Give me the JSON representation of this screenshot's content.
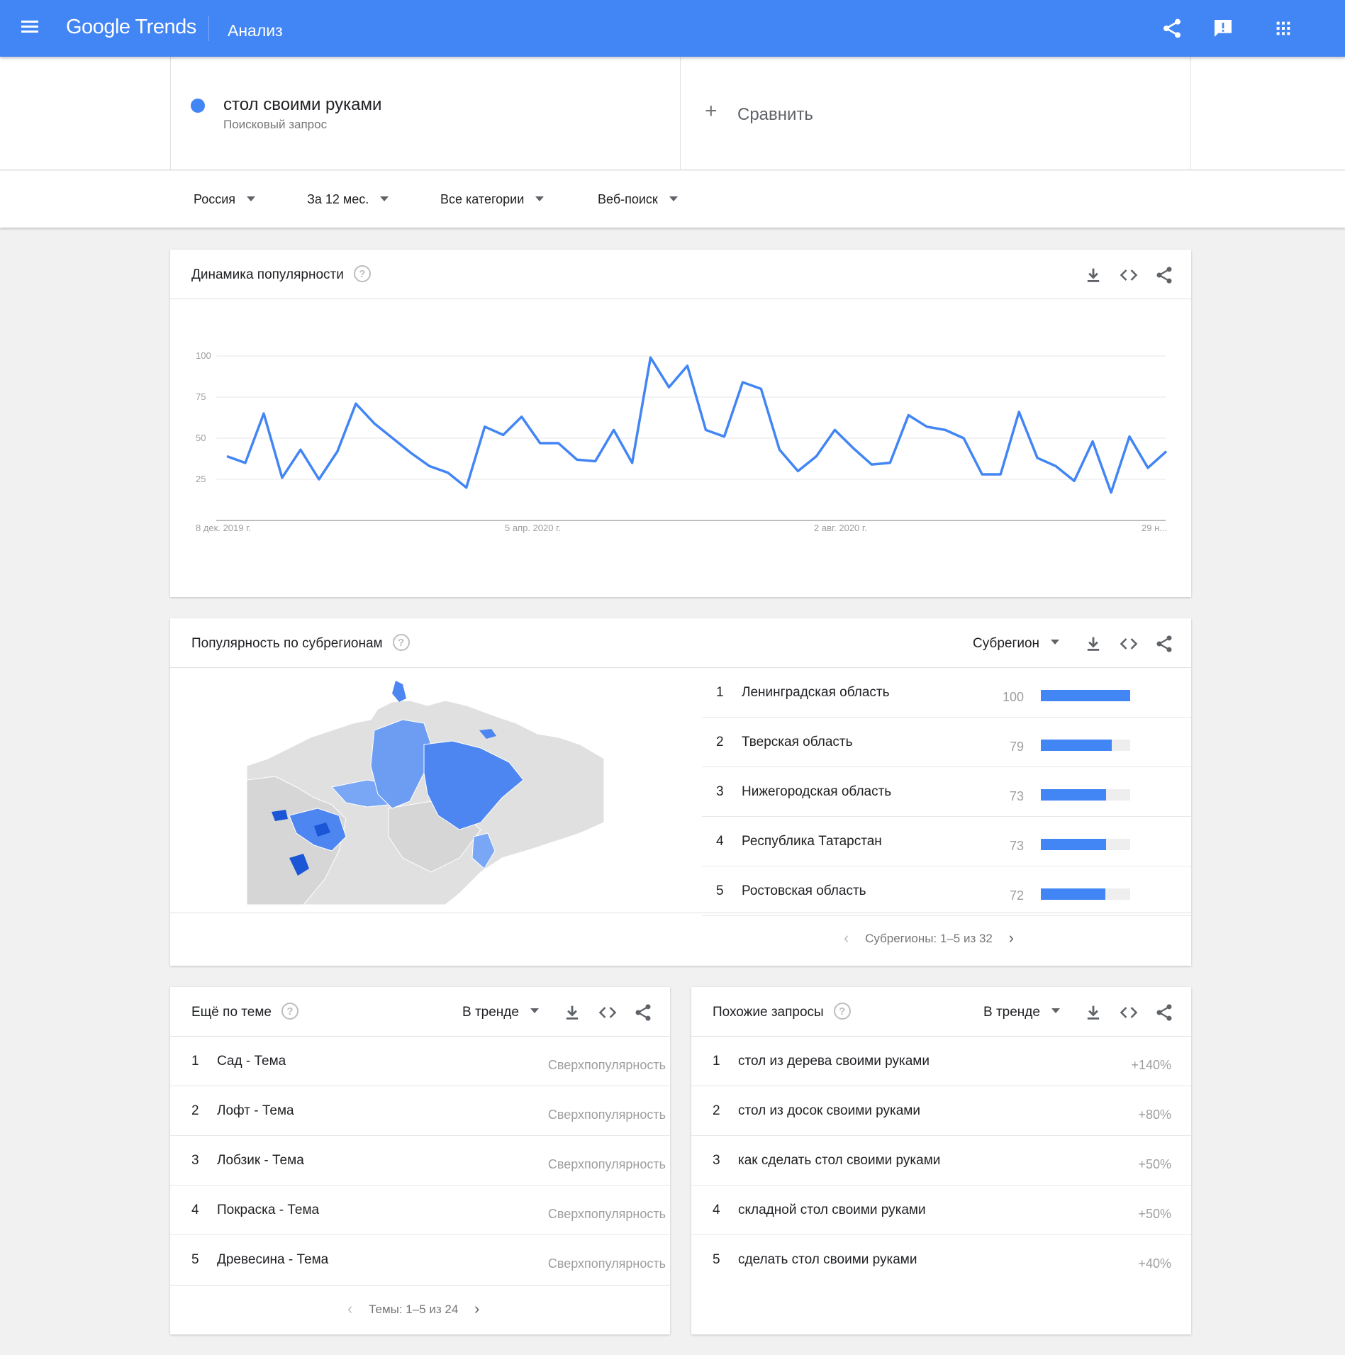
{
  "header": {
    "logo": "Google Trends",
    "page_title": "Анализ",
    "icons": [
      "menu-icon",
      "share-icon",
      "feedback-icon",
      "apps-icon"
    ]
  },
  "search": {
    "term": "стол своими руками",
    "term_type": "Поисковый запрос",
    "term_color": "#4285f4",
    "compare_label": "Сравнить"
  },
  "filters": {
    "region": "Россия",
    "period": "За 12 мес.",
    "category": "Все категории",
    "search_type": "Веб-поиск"
  },
  "trend_card": {
    "title": "Динамика популярности",
    "chart_data": {
      "type": "line",
      "x_tick_labels": [
        "8 дек. 2019 г.",
        "5 апр. 2020 г.",
        "2 авг. 2020 г.",
        "29 н..."
      ],
      "y_ticks": [
        25,
        50,
        75,
        100
      ],
      "ylim": [
        0,
        100
      ],
      "grid": true,
      "series": [
        {
          "color": "#4285f4",
          "values": [
            39,
            35,
            65,
            26,
            43,
            25,
            42,
            71,
            59,
            50,
            41,
            33,
            29,
            20,
            57,
            52,
            63,
            47,
            47,
            37,
            36,
            55,
            35,
            99,
            81,
            94,
            55,
            51,
            84,
            80,
            43,
            30,
            39,
            55,
            44,
            34,
            35,
            64,
            57,
            55,
            50,
            28,
            28,
            66,
            38,
            33,
            24,
            48,
            17,
            51,
            32,
            42
          ]
        }
      ]
    }
  },
  "region_card": {
    "title": "Популярность по субрегионам",
    "selector": "Субрегион",
    "map_colors": {
      "high": "#1a56d6",
      "mid": "#4d86f0",
      "low": "#7aa7f5",
      "none": "#e0e0e0"
    },
    "rows": [
      {
        "rank": "1",
        "name": "Ленинградская область",
        "value": "100",
        "fill": 100
      },
      {
        "rank": "2",
        "name": "Тверская область",
        "value": "79",
        "fill": 79
      },
      {
        "rank": "3",
        "name": "Нижегородская область",
        "value": "73",
        "fill": 73
      },
      {
        "rank": "4",
        "name": "Республика Татарстан",
        "value": "73",
        "fill": 73
      },
      {
        "rank": "5",
        "name": "Ростовская область",
        "value": "72",
        "fill": 72
      }
    ],
    "pager": "Субрегионы: 1–5 из 32"
  },
  "topics_card": {
    "title": "Ещё по теме",
    "selector": "В тренде",
    "rows": [
      {
        "rank": "1",
        "label": "Сад - Тема",
        "value": "Сверхпопулярность"
      },
      {
        "rank": "2",
        "label": "Лофт - Тема",
        "value": "Сверхпопулярность"
      },
      {
        "rank": "3",
        "label": "Лобзик - Тема",
        "value": "Сверхпопулярность"
      },
      {
        "rank": "4",
        "label": "Покраска - Тема",
        "value": "Сверхпопулярность"
      },
      {
        "rank": "5",
        "label": "Древесина - Тема",
        "value": "Сверхпопулярность"
      }
    ],
    "pager": "Темы: 1–5 из 24"
  },
  "queries_card": {
    "title": "Похожие запросы",
    "selector": "В тренде",
    "rows": [
      {
        "rank": "1",
        "label": "стол из дерева своими руками",
        "value": "+140%"
      },
      {
        "rank": "2",
        "label": "стол из досок своими руками",
        "value": "+80%"
      },
      {
        "rank": "3",
        "label": "как сделать стол своими руками",
        "value": "+50%"
      },
      {
        "rank": "4",
        "label": "складной стол своими руками",
        "value": "+50%"
      },
      {
        "rank": "5",
        "label": "сделать стол своими руками",
        "value": "+40%"
      }
    ]
  }
}
